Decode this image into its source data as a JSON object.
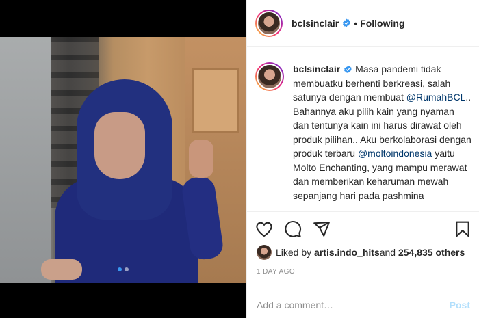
{
  "post": {
    "username": "bclsinclair",
    "separator": "•",
    "follow_status": "Following"
  },
  "caption": {
    "username": "bclsinclair",
    "text_1": "Masa pandemi tidak membuatku berhenti berkreasi, salah satunya dengan membuat ",
    "mention_1": "@RumahBCL",
    "text_2": ".. Bahannya aku pilih kain yang nyaman dan tentunya kain ini harus dirawat oleh produk pilihan.. Aku berkolaborasi dengan produk terbaru ",
    "mention_2": "@moltoindonesia",
    "text_3": " yaitu Molto Enchanting, yang mampu merawat dan memberikan keharuman mewah sepanjang hari pada pashmina"
  },
  "likes": {
    "prefix": "Liked by ",
    "liker": "artis.indo_hits",
    "middle": " and ",
    "count": "254,835 others"
  },
  "timestamp": "1 DAY AGO",
  "comment": {
    "placeholder": "Add a comment…",
    "post_label": "Post"
  },
  "carousel": {
    "total": 2,
    "active_index": 0
  },
  "colors": {
    "accent_blue": "#0095f6",
    "mention_blue": "#00376b",
    "post_disabled": "#b2dffc",
    "muted": "#8e8e8e"
  }
}
